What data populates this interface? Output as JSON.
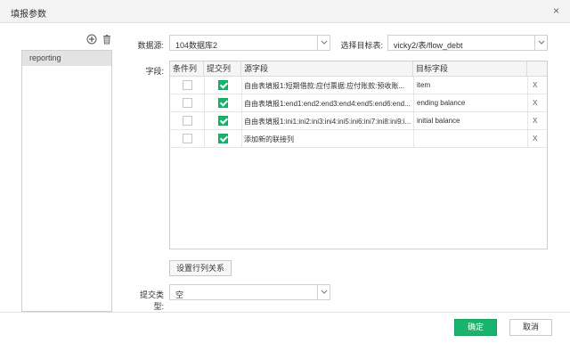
{
  "dialog": {
    "title": "填报参数",
    "close_glyph": "×"
  },
  "left_panel": {
    "items": [
      {
        "label": "reporting"
      }
    ]
  },
  "form": {
    "datasource_label": "数据源:",
    "datasource_value": "104数据库2",
    "target_label": "选择目标表:",
    "target_value": "vicky2/表/flow_debt",
    "fields_label": "字段:",
    "submit_type_label": "提交类型:",
    "submit_type_value": "空"
  },
  "table": {
    "headers": [
      "条件列",
      "提交列",
      "源字段",
      "目标字段"
    ],
    "rows": [
      {
        "condition": false,
        "submit": true,
        "source": "自由表填报1:短期借款:应付票据:应付账款:预收账...",
        "target": "item",
        "delete": "X"
      },
      {
        "condition": false,
        "submit": true,
        "source": "自由表填报1:end1:end2:end3:end4:end5:end6:end...",
        "target": "ending balance",
        "delete": "X"
      },
      {
        "condition": false,
        "submit": true,
        "source": "自由表填报1:ini1:ini2:ini3:ini4:ini5:ini6:ini7:ini8:ini9:i...",
        "target": "initial balance",
        "delete": "X"
      },
      {
        "condition": false,
        "submit": true,
        "source": "添加新的联接列",
        "target": "",
        "delete": "X"
      }
    ]
  },
  "buttons": {
    "set_relation": "设置行列关系",
    "ok": "确定",
    "cancel": "取消"
  },
  "icons": {
    "add": "plus-circle-icon",
    "delete": "trash-icon",
    "dropdown": "chevron-down-icon"
  },
  "colors": {
    "accent": "#19b36c"
  }
}
